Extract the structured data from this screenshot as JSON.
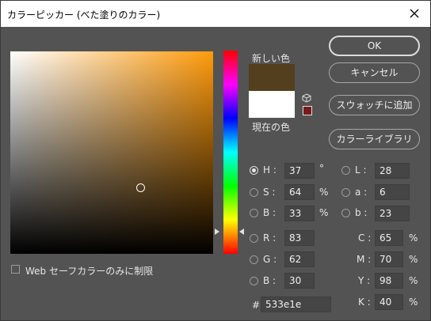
{
  "window": {
    "title": "カラーピッカー (べた塗りのカラー)"
  },
  "colors": {
    "new": "#533e1e",
    "current": "#ffffff",
    "background": "#535353"
  },
  "swatch": {
    "new_label": "新しい色",
    "current_label": "現在の色"
  },
  "buttons": {
    "ok": "OK",
    "cancel": "キャンセル",
    "add_swatch": "スウォッチに追加",
    "libraries": "カラーライブラリ"
  },
  "hsb": {
    "h": {
      "label": "H :",
      "value": "37",
      "unit": "°",
      "selected": true
    },
    "s": {
      "label": "S :",
      "value": "64",
      "unit": "%"
    },
    "b": {
      "label": "B :",
      "value": "33",
      "unit": "%"
    }
  },
  "lab": {
    "l": {
      "label": "L :",
      "value": "28"
    },
    "a": {
      "label": "a :",
      "value": "6"
    },
    "b": {
      "label": "b :",
      "value": "23"
    }
  },
  "rgb": {
    "r": {
      "label": "R :",
      "value": "83"
    },
    "g": {
      "label": "G :",
      "value": "62"
    },
    "b": {
      "label": "B :",
      "value": "30"
    }
  },
  "cmyk": {
    "c": {
      "label": "C :",
      "value": "65",
      "unit": "%"
    },
    "m": {
      "label": "M :",
      "value": "70",
      "unit": "%"
    },
    "y": {
      "label": "Y :",
      "value": "98",
      "unit": "%"
    },
    "k": {
      "label": "K :",
      "value": "40",
      "unit": "%"
    }
  },
  "hex": {
    "label": "#",
    "value": "533e1e"
  },
  "web_safe": {
    "label": "Web セーフカラーのみに制限",
    "checked": false
  }
}
